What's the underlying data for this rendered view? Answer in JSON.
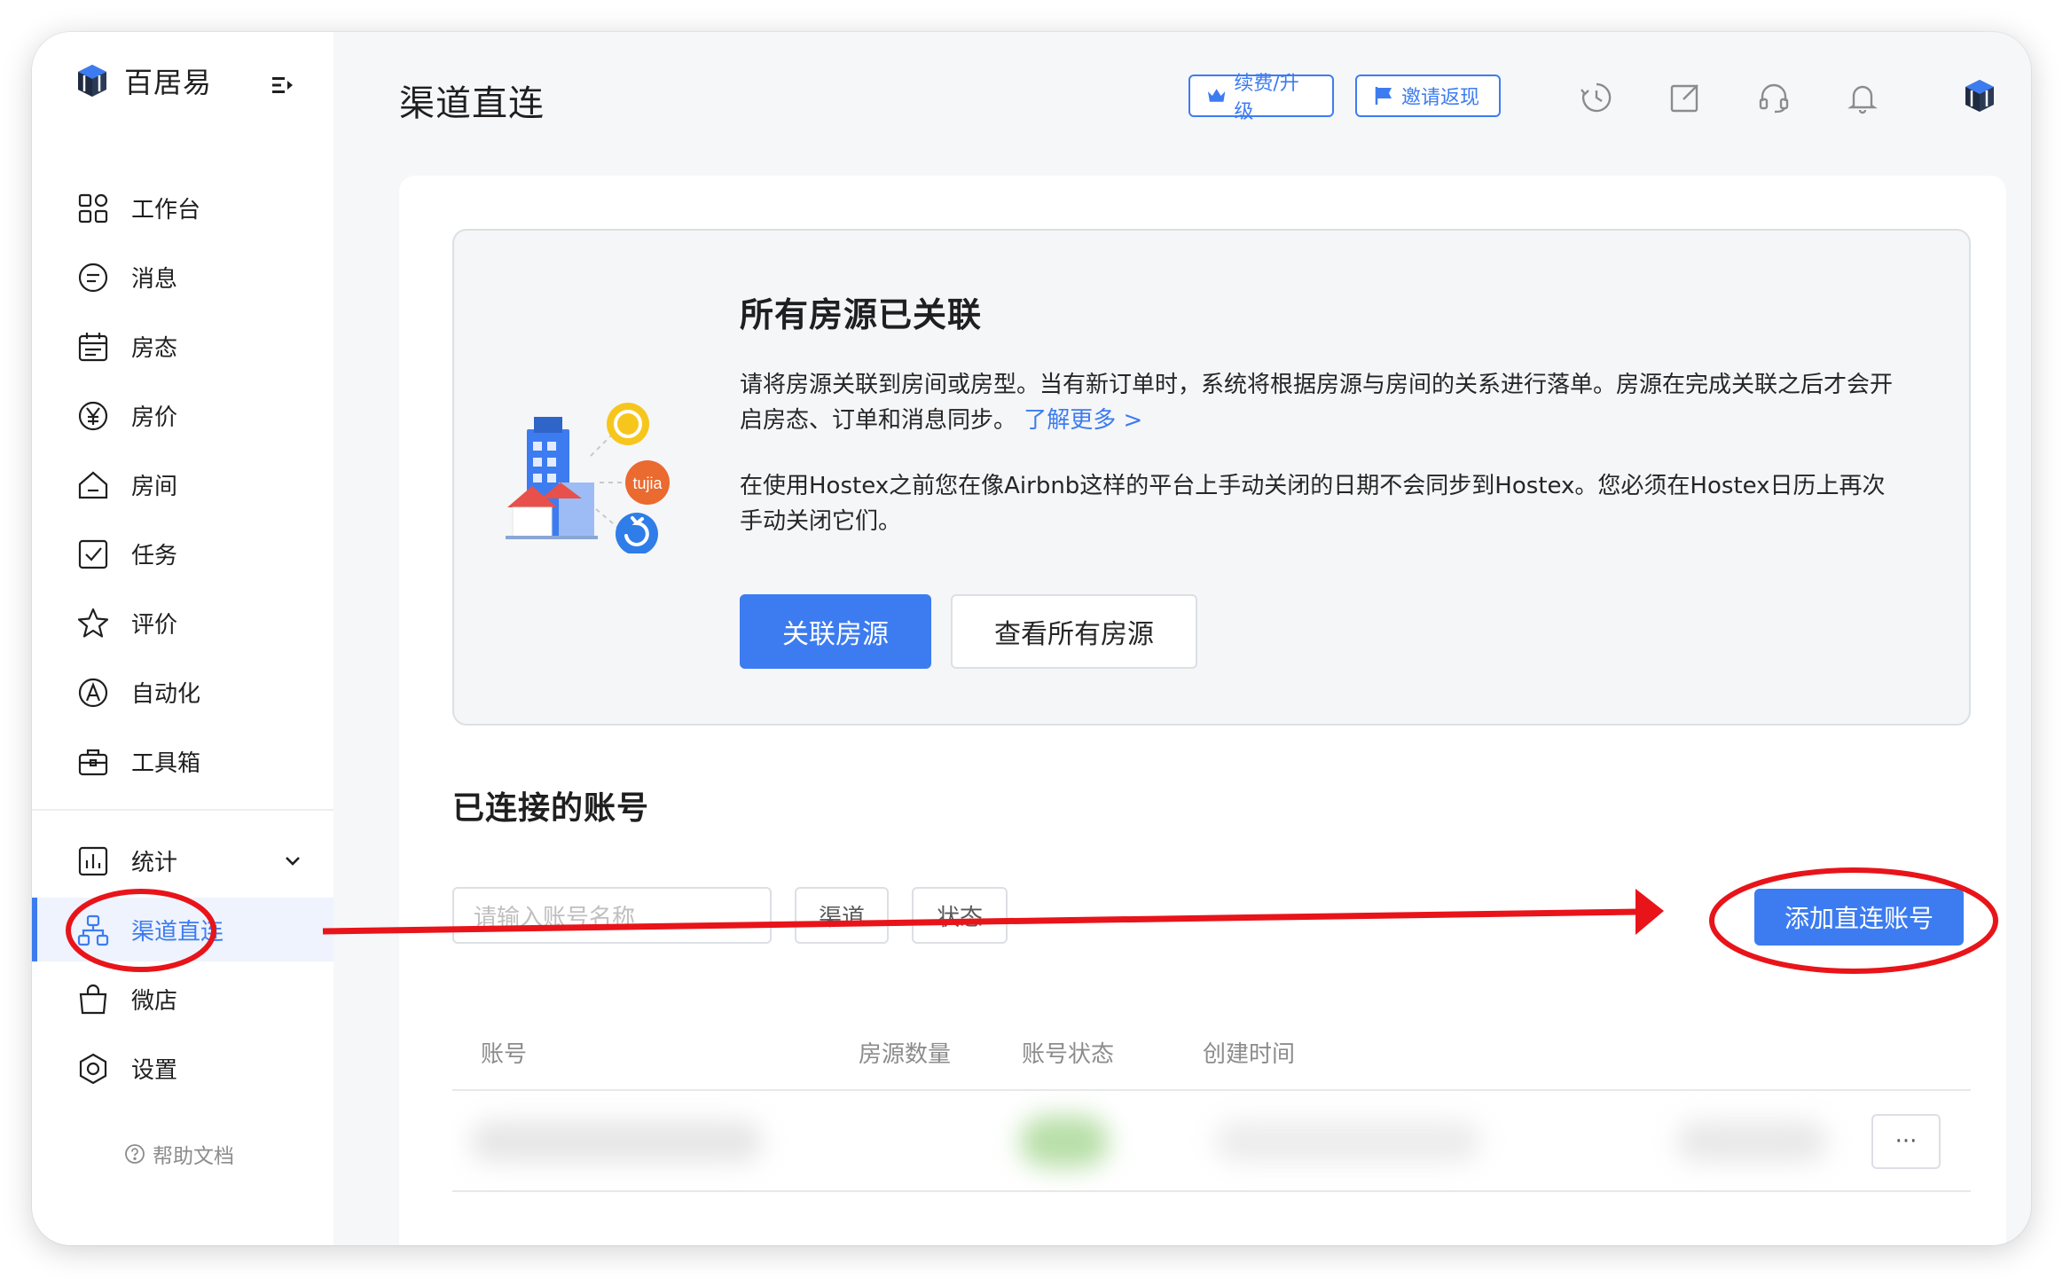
{
  "app": {
    "brand": "百居易",
    "page_title": "渠道直连"
  },
  "header": {
    "renew_label": "续费/升级",
    "invite_label": "邀请返现"
  },
  "sidebar": {
    "items": [
      {
        "label": "工作台",
        "icon": "dashboard-icon"
      },
      {
        "label": "消息",
        "icon": "message-icon"
      },
      {
        "label": "房态",
        "icon": "calendar-icon"
      },
      {
        "label": "房价",
        "icon": "yen-icon"
      },
      {
        "label": "房间",
        "icon": "home-icon"
      },
      {
        "label": "任务",
        "icon": "task-check-icon"
      },
      {
        "label": "评价",
        "icon": "star-icon"
      },
      {
        "label": "自动化",
        "icon": "automation-icon"
      },
      {
        "label": "工具箱",
        "icon": "toolbox-icon"
      },
      {
        "label": "统计",
        "icon": "stats-icon"
      },
      {
        "label": "渠道直连",
        "icon": "channel-icon",
        "active": true
      },
      {
        "label": "微店",
        "icon": "shop-icon"
      },
      {
        "label": "设置",
        "icon": "settings-icon"
      }
    ],
    "help_label": "帮助文档"
  },
  "info": {
    "title": "所有房源已关联",
    "p1": "请将房源关联到房间或房型。当有新订单时，系统将根据房源与房间的关系进行落单。房源在完成关联之后才会开启房态、订单和消息同步。",
    "learn_more": "了解更多 >",
    "p2": "在使用Hostex之前您在像Airbnb这样的平台上手动关闭的日期不会同步到Hostex。您必须在Hostex日历上再次手动关闭它们。",
    "primary_btn": "关联房源",
    "secondary_btn": "查看所有房源",
    "badge_text": "tujia"
  },
  "accounts": {
    "title": "已连接的账号",
    "search_placeholder": "请输入账号名称",
    "filter_channel": "渠道",
    "filter_status": "状态",
    "add_btn": "添加直连账号",
    "columns": [
      "账号",
      "房源数量",
      "账号状态",
      "创建时间"
    ],
    "row_more": "···"
  },
  "colors": {
    "accent": "#3d7cf0",
    "annotation": "#e8141a"
  }
}
